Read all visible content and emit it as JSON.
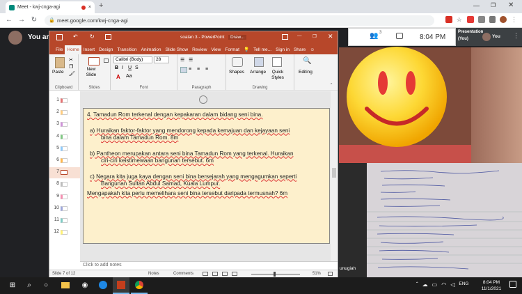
{
  "browser": {
    "tab_title": "Meet - kwj-cnga-agi",
    "url": "meet.google.com/kwj-cnga-agi"
  },
  "meet": {
    "presenter_label": "You ar",
    "time": "8:04 PM",
    "participants_count": "3",
    "self_tile_title": "Presentation",
    "self_tile_sub": "(You)",
    "self_tile_name": "You",
    "bottom_name": "unugiah"
  },
  "ppt": {
    "title": "soalan 3 - PowerPoint",
    "draw_label": "Draw...",
    "tell_me": "Tell me...",
    "signin": "Sign in",
    "share": "Share",
    "tabs": [
      "File",
      "Home",
      "Insert",
      "Design",
      "Transition",
      "Animation",
      "Slide Show",
      "Review",
      "View",
      "Format"
    ],
    "ribbon": {
      "paste": "Paste",
      "new_slide": "New Slide",
      "font_name": "Calibri (Body)",
      "font_size": "28",
      "shapes": "Shapes",
      "arrange": "Arrange",
      "quick_styles": "Quick Styles",
      "editing": "Editing",
      "groups": [
        "Clipboard",
        "Slides",
        "Font",
        "Paragraph",
        "Drawing"
      ]
    },
    "thumbnails": [
      "1",
      "2",
      "3",
      "4",
      "5",
      "6",
      "7",
      "8",
      "9",
      "10",
      "11",
      "12"
    ],
    "slide": {
      "heading": "4. Tamadun Rom terkenal dengan kepakaran dalam bidang seni bina.",
      "qa_1": "a)   Huraikan faktor-faktor yang mendorong kepada kemajuan dan kejayaan seni",
      "qa_2": "bina dalam Tamadun Rom. 8m",
      "qb_1": "b)   Pantheon merupakan antara seni bina Tamadun Rom yang terkenal. Huraikan",
      "qb_2": "ciri-ciri keistimewaan bangunan tersebut. 6m",
      "qc_1": "c)   Negara kita juga kaya dengan seni bina bersejarah yang mengagumkan seperti",
      "qc_2": "Bangunan Sultan Abdul Samad, Kuala Lumpur.",
      "qc_3": "Mengapakah kita perlu memelihara seni bina tersebut daripada termusnah? 6m"
    },
    "notes_placeholder": "Click to add notes",
    "status": {
      "slide": "Slide 7 of 12",
      "notes": "Notes",
      "comments": "Comments",
      "zoom": "51%"
    }
  },
  "taskbar": {
    "time": "8:04 PM",
    "date": "11/1/2021",
    "lang": "ENG"
  },
  "colors": {
    "ppt_accent": "#b7472a",
    "slide_bg": "#fdf0cc",
    "meet_bg": "#202124"
  }
}
